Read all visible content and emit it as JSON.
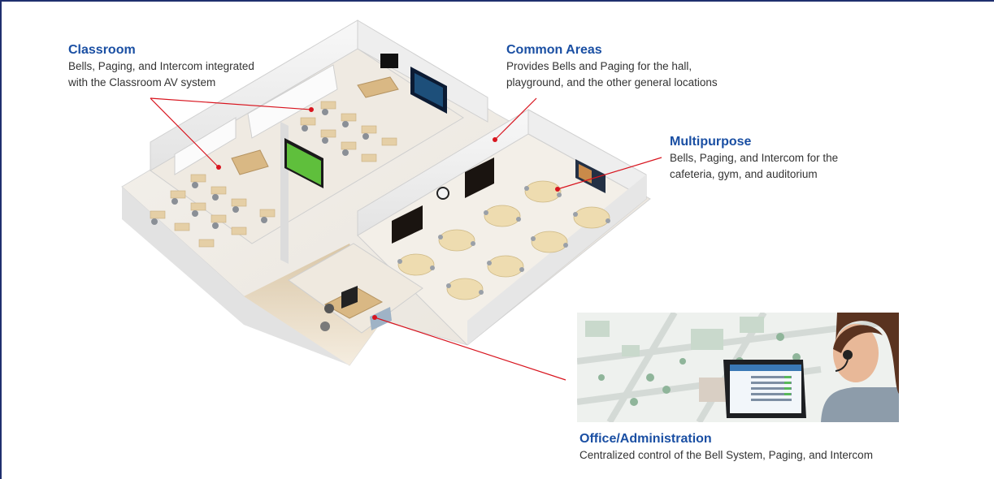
{
  "colors": {
    "title": "#1a4fa3",
    "text": "#333333",
    "leader": "#d8141e",
    "frame": "#1f2f6e"
  },
  "areas": {
    "classroom": {
      "title": "Classroom",
      "line1": "Bells, Paging, and Intercom integrated",
      "line2": "with the Classroom AV system"
    },
    "common": {
      "title": "Common Areas",
      "line1": "Provides Bells and Paging for the hall,",
      "line2": "playground, and the other general locations"
    },
    "multipurpose": {
      "title": "Multipurpose",
      "line1": "Bells, Paging, and Intercom for the",
      "line2": "cafeteria, gym, and auditorium"
    },
    "office": {
      "title": "Office/Administration",
      "line1": "Centralized control of the Bell System, Paging, and Intercom"
    }
  }
}
